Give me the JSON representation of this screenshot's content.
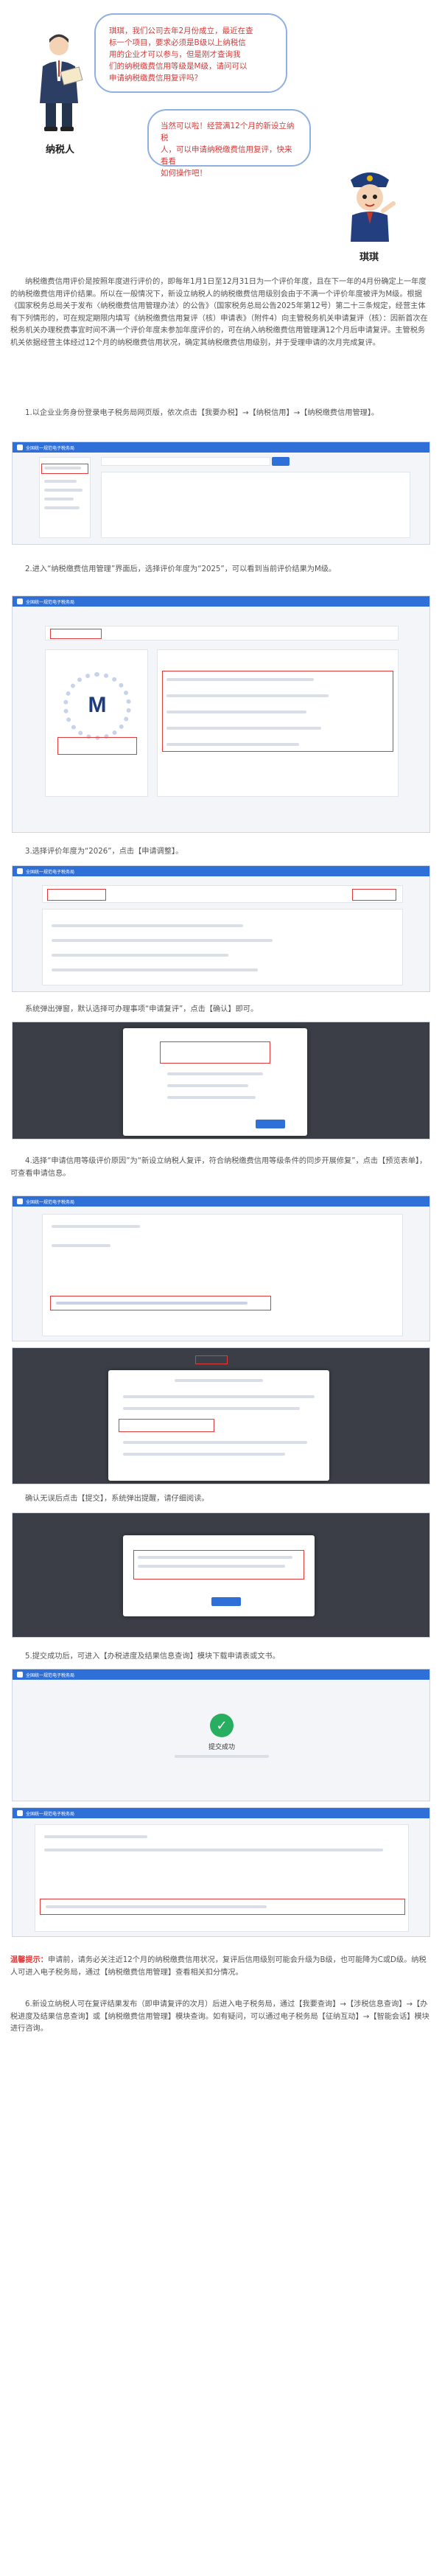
{
  "dialogue": {
    "taxpayer_question": "琪琪，我们公司去年2月份成立，最近在查看一个项目，要求必须是B级以上纳税信用的企业才可以参与，但是刚才查询我们的纳税缴费信用等级是M级，请问可以申请纳税缴费信用复评吗？",
    "taxpayer_lines": [
      "琪琪，我们公司去年2月份成立，最近在查",
      "标一个项目，要求必须是B级以上纳税信",
      "用的企业才可以参与，但是刚才查询我",
      "们的纳税缴费信用等级是M级，请问可以",
      "申请纳税缴费信用复评吗？"
    ],
    "taxpayer_label": "纳税人",
    "officer_lines": [
      "当然可以啦！经营满12个月的新设立纳税",
      "人，可以申请纳税缴费信用复评，快来看看",
      "如何操作吧！"
    ],
    "officer_label": "琪琪"
  },
  "intro": "纳税缴费信用评价是按照年度进行评价的，即每年1月1日至12月31日为一个评价年度，且在下一年的4月份确定上一年度的纳税缴费信用评价结果。所以在一般情况下，新设立纳税人的纳税缴费信用级别会由于不满一个评价年度被评为M级。根据《国家税务总局关于发布〈纳税缴费信用管理办法〉的公告》（国家税务总局公告2025年第12号）第二十三条规定，经营主体有下列情形的，可在规定期限内填写《纳税缴费信用复评（核）申请表》（附件4）向主管税务机关申请复评（核）：因新首次在税务机关办理税费事宜时间不满一个评价年度未参加年度评价的，可在纳入纳税缴费信用管理满12个月后申请复评。主管税务机关依据经营主体经过12个月的纳税缴费信用状况，确定其纳税缴费信用级别，并于受理申请的次月完成复评。",
  "steps": {
    "s1": "1.以企业业务身份登录电子税务局网页版，依次点击【我要办税】→【纳税信用】→【纳税缴费信用管理】。",
    "s2": "2.进入“纳税缴费信用管理”界面后，选择评价年度为“2025”，可以看到当前评价结果为M级。",
    "s3": "3.选择评价年度为“2026”，点击【申请调整】。",
    "s3b": "系统弹出弹窗，默认选择可办理事项“申请复评”，点击【确认】即可。",
    "s4": "4.选择“申请信用等级评价原因”为“新设立纳税人复评，符合纳税缴费信用等级条件的同步开展修复”，点击【预览表单】，可查看申请信息。",
    "s4b": "确认无误后点击【提交】，系统弹出提醒，请仔细阅读。",
    "s5": "5.提交成功后，可进入【办税进度及结果信息查询】模块下载申请表或文书。"
  },
  "shots": {
    "portal_title": "全国统一规范电子税务局",
    "credit_level": "M",
    "success_text": "提交成功"
  },
  "tips": {
    "label": "温馨提示：",
    "t1": "申请前，请务必关注近12个月的纳税缴费信用状况，复评后信用级别可能会升级为B级，也可能降为C或D级。纳税人可进入电子税务局，通过【纳税缴费信用管理】查看相关扣分情况。",
    "t2": "6.新设立纳税人可在复评结果发布（即申请复评的次月）后进入电子税务局，通过【我要查询】→【涉税信息查询】→【办税进度及结果信息查询】或【纳税缴费信用管理】模块查询。如有疑问，可以通过电子税务局【征纳互动】→【智能会话】模块进行咨询。"
  },
  "colors": {
    "accent": "#2f6fd8",
    "highlight": "#e23b3b",
    "bubble_text": "#d43a3a"
  }
}
